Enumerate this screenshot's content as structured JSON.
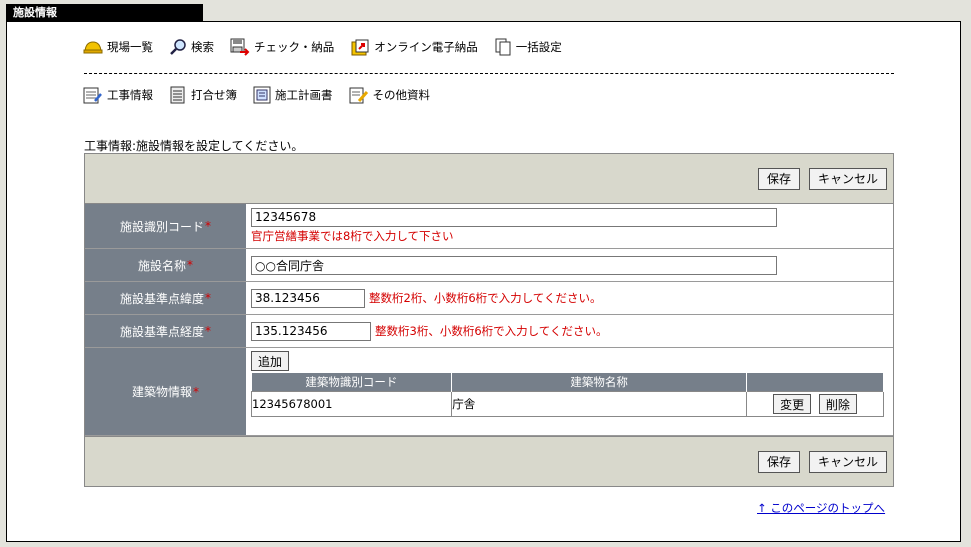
{
  "tab_title": "施設情報",
  "nav_primary": [
    {
      "label": "現場一覧",
      "icon": "hardhat-icon"
    },
    {
      "label": "検索",
      "icon": "magnifier-icon"
    },
    {
      "label": "チェック・納品",
      "icon": "disk-check-icon"
    },
    {
      "label": "オンライン電子納品",
      "icon": "online-delivery-icon"
    },
    {
      "label": "一括設定",
      "icon": "copy-document-icon"
    }
  ],
  "nav_secondary": [
    {
      "label": "工事情報",
      "icon": "construction-info-icon"
    },
    {
      "label": "打合せ簿",
      "icon": "meeting-record-icon"
    },
    {
      "label": "施工計画書",
      "icon": "construction-plan-icon"
    },
    {
      "label": "その他資料",
      "icon": "other-documents-icon"
    }
  ],
  "instruction": "工事情報:施設情報を設定してください。",
  "buttons": {
    "save": "保存",
    "cancel": "キャンセル",
    "add": "追加",
    "edit": "変更",
    "delete": "削除"
  },
  "required_mark": "*",
  "fields": {
    "code": {
      "label": "施設識別コード",
      "value": "12345678",
      "hint": "官庁営繕事業では8桁で入力して下さい"
    },
    "name": {
      "label": "施設名称",
      "value": "○○合同庁舎"
    },
    "latitude": {
      "label": "施設基準点緯度",
      "value": "38.123456",
      "hint": "整数桁2桁、小数桁6桁で入力してください。"
    },
    "longitude": {
      "label": "施設基準点経度",
      "value": "135.123456",
      "hint": "整数桁3桁、小数桁6桁で入力してください。"
    },
    "buildings": {
      "label": "建築物情報",
      "columns": [
        "建築物識別コード",
        "建築物名称",
        ""
      ],
      "rows": [
        {
          "code": "12345678001",
          "name": "庁舎"
        }
      ]
    }
  },
  "top_link": "↑ このページのトップへ"
}
